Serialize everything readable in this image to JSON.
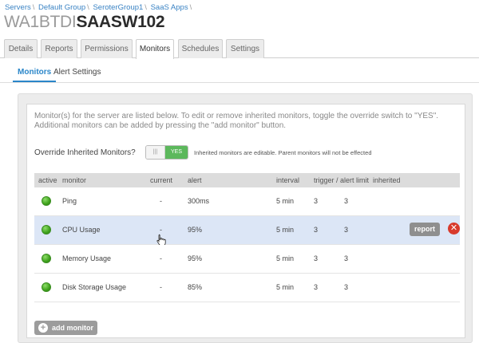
{
  "breadcrumb": [
    "Servers",
    "Default Group",
    "SeroterGroup1",
    "SaaS Apps"
  ],
  "title": {
    "prefix": "WA1BTDI",
    "name": "SAASW102"
  },
  "tabs": [
    {
      "label": "Details"
    },
    {
      "label": "Reports"
    },
    {
      "label": "Permissions"
    },
    {
      "label": "Monitors",
      "active": true
    },
    {
      "label": "Schedules"
    },
    {
      "label": "Settings"
    }
  ],
  "subtabs": [
    {
      "label": "Monitors",
      "active": true
    },
    {
      "label": "Alert Settings"
    }
  ],
  "intro": "Monitor(s) for the server are listed below. To edit or remove inherited monitors, toggle the override switch to \"YES\". Additional monitors can be added by pressing the \"add monitor\" button.",
  "override": {
    "label": "Override Inherited Monitors?",
    "toggle_off": "|||",
    "toggle_on": "YES",
    "note": "Inherited monitors are editable. Parent monitors will not be effected"
  },
  "table": {
    "columns": [
      "active",
      "monitor",
      "current",
      "alert",
      "interval",
      "trigger / alert limit",
      "inherited"
    ],
    "rows": [
      {
        "monitor": "Ping",
        "current": "-",
        "alert": "300ms",
        "interval": "5 min",
        "trigger": "3",
        "limit": "3"
      },
      {
        "monitor": "CPU Usage",
        "current": "-",
        "alert": "95%",
        "interval": "5 min",
        "trigger": "3",
        "limit": "3"
      },
      {
        "monitor": "Memory Usage",
        "current": "-",
        "alert": "95%",
        "interval": "5 min",
        "trigger": "3",
        "limit": "3"
      },
      {
        "monitor": "Disk Storage Usage",
        "current": "-",
        "alert": "85%",
        "interval": "5 min",
        "trigger": "3",
        "limit": "3"
      }
    ]
  },
  "row_actions": {
    "report_label": "report",
    "remove_glyph": "✕"
  },
  "add_monitor": {
    "plus": "+",
    "label": "add monitor"
  },
  "colors": {
    "accent": "#2a86c9",
    "status_ok": "#3ea21c",
    "danger": "#d83a2c",
    "selected_row": "#dce6f6"
  }
}
